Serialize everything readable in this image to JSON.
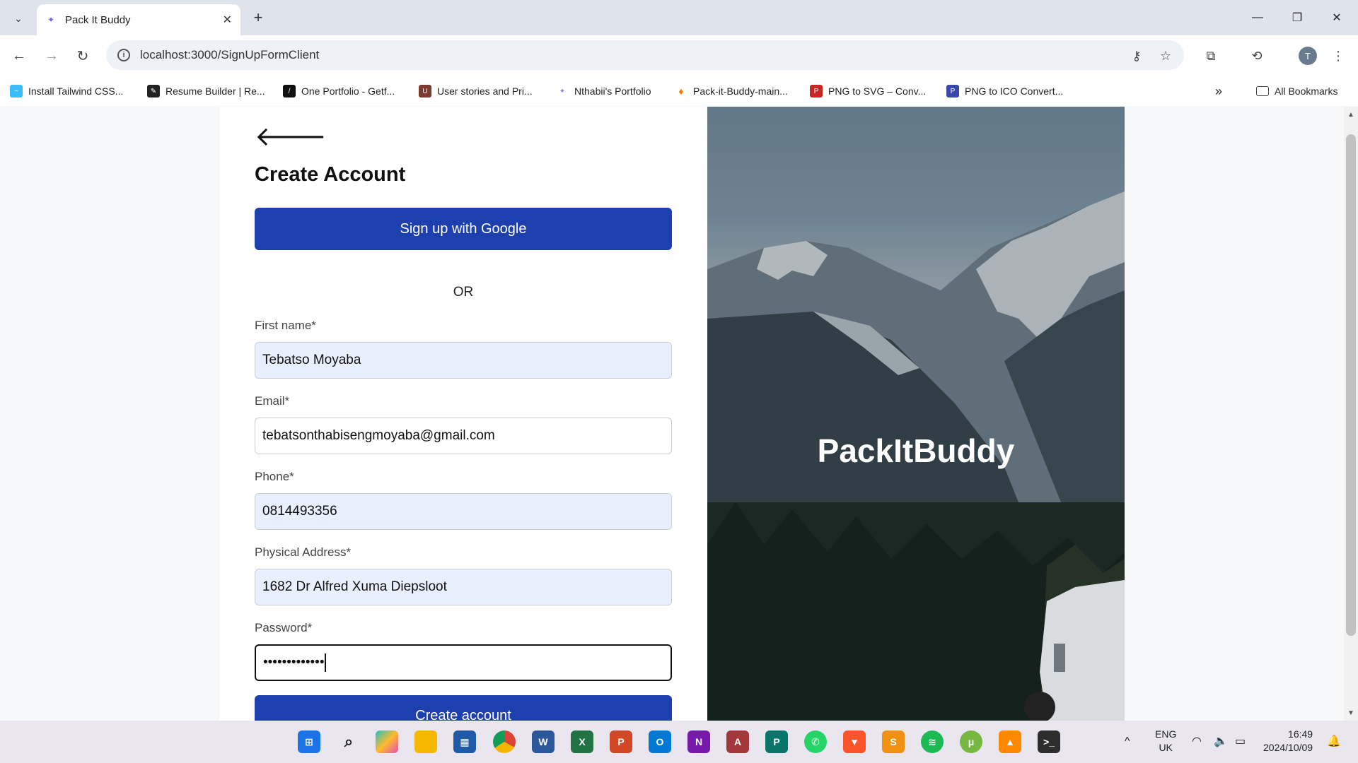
{
  "browser": {
    "tab_title": "Pack It Buddy",
    "url": "localhost:3000/SignUpFormClient",
    "profile_initial": "T",
    "bookmarks": [
      {
        "label": "Install Tailwind CSS...",
        "icon": "tailwind-icon",
        "color": "#38bdf8"
      },
      {
        "label": "Resume Builder | Re...",
        "icon": "resume-icon",
        "color": "#222222"
      },
      {
        "label": "One Portfolio - Getf...",
        "icon": "portfolio-icon",
        "color": "#111111"
      },
      {
        "label": "User stories and Pri...",
        "icon": "userstories-icon",
        "color": "#7a3b2e"
      },
      {
        "label": "Nthabii's Portfolio",
        "icon": "nthabii-icon",
        "color": "#9b7ad8"
      },
      {
        "label": "Pack-it-Buddy-main...",
        "icon": "firebase-icon",
        "color": "#f57c00"
      },
      {
        "label": "PNG to SVG – Conv...",
        "icon": "pngsvg-icon",
        "color": "#c62828"
      },
      {
        "label": "PNG to ICO Convert...",
        "icon": "pngico-icon",
        "color": "#3949ab"
      }
    ],
    "all_bookmarks": "All Bookmarks"
  },
  "form": {
    "heading": "Create Account",
    "google_button": "Sign up with Google",
    "or_text": "OR",
    "first_name_label": "First name*",
    "first_name_value": "Tebatso Moyaba",
    "email_label": "Email*",
    "email_value": "tebatsonthabisengmoyaba@gmail.com",
    "phone_label": "Phone*",
    "phone_value": "0814493356",
    "address_label": "Physical Address*",
    "address_value": "1682 Dr Alfred Xuma Diepsloot",
    "password_label": "Password*",
    "password_value": "•••••••••••••",
    "create_button": "Create account"
  },
  "hero": {
    "brand": "PackItBuddy"
  },
  "taskbar": {
    "lang_top": "ENG",
    "lang_bottom": "UK",
    "time": "16:49",
    "date": "2024/10/09"
  }
}
